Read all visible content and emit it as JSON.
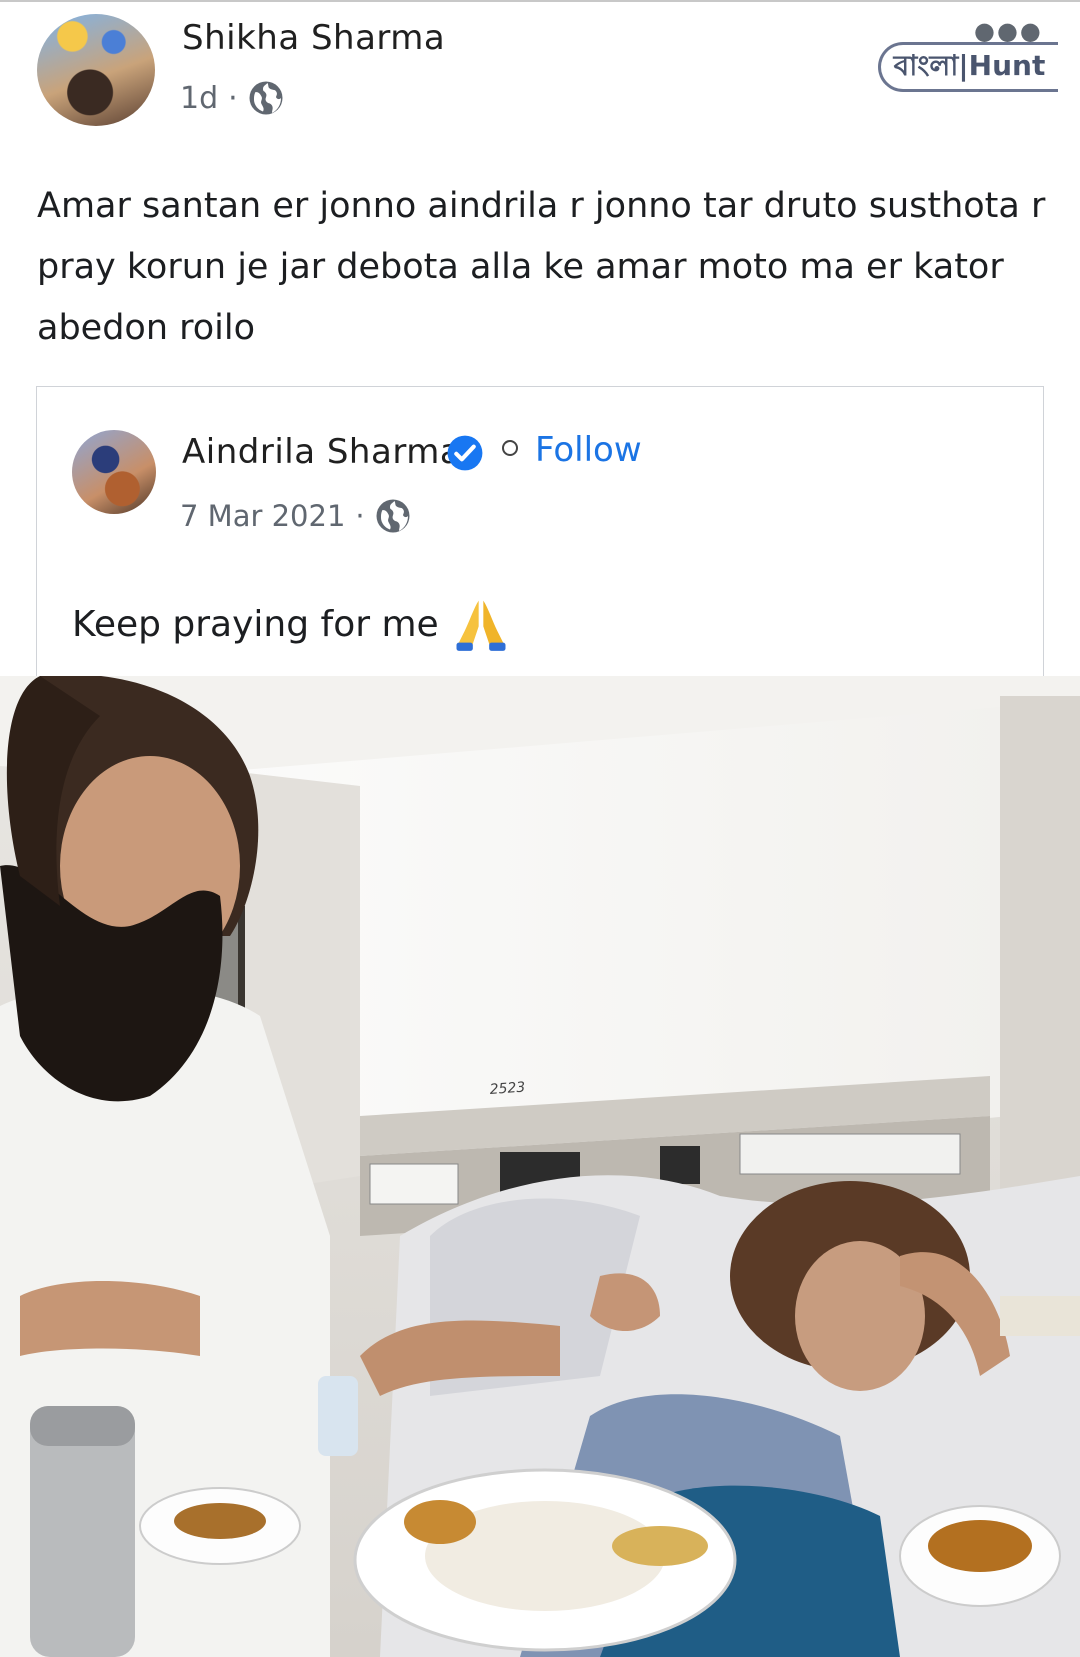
{
  "post": {
    "author": "Shikha Sharma",
    "time": "1d",
    "separator": "·",
    "text": "Amar santan er jonno aindrila r jonno tar druto susthota r pray korun je jar debota alla ke  amar moto ma er kator abedon roilo"
  },
  "watermark": {
    "brand": "বাংলা|Hunt"
  },
  "shared": {
    "author": "Aindrila Sharma",
    "follow_label": "Follow",
    "date": "7 Mar 2021",
    "separator": "·",
    "text": "Keep praying for me"
  },
  "photo": {
    "wall_label": "2523"
  },
  "icons": {
    "globe": "globe-icon",
    "more": "more-options-icon",
    "verified": "verified-badge-icon",
    "pray": "folded-hands-emoji"
  },
  "colors": {
    "link": "#1b74e4",
    "verified": "#1877f2",
    "muted": "#606770"
  }
}
